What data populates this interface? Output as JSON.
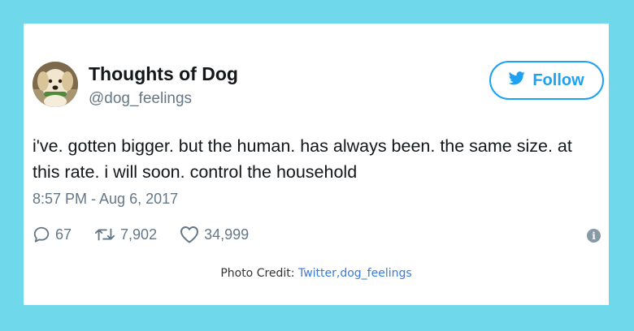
{
  "tweet": {
    "display_name": "Thoughts of Dog",
    "handle": "@dog_feelings",
    "follow_label": "Follow",
    "text": "i've. gotten bigger. but the human. has always been. the same size. at this rate. i will soon. control the household",
    "timestamp": "8:57 PM - Aug 6, 2017",
    "reply_count": "67",
    "retweet_count": "7,902",
    "like_count": "34,999"
  },
  "credit": {
    "prefix": "Photo Credit: ",
    "link": "Twitter,dog_feelings"
  },
  "colors": {
    "background": "#6fd8eb",
    "twitter_blue": "#1da1f2",
    "secondary_text": "#657786"
  },
  "icons": {
    "follow": "twitter-bird-icon",
    "reply": "reply-icon",
    "retweet": "retweet-icon",
    "like": "heart-icon",
    "info": "info-icon"
  }
}
